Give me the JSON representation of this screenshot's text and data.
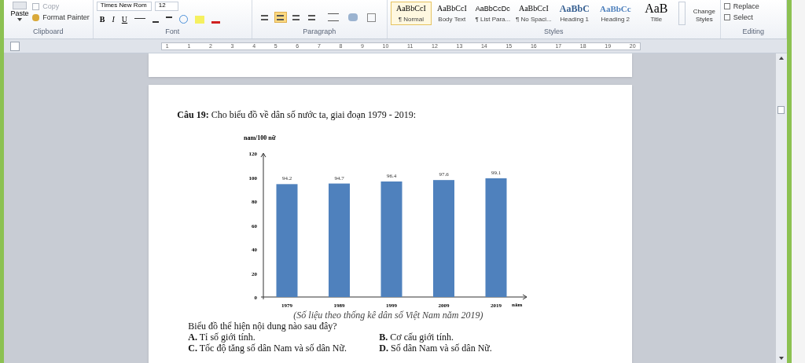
{
  "ribbon": {
    "clipboard": {
      "paste": "Paste",
      "items": [
        {
          "label": "Copy",
          "disabled": true
        },
        {
          "label": "Format Painter",
          "disabled": false
        }
      ],
      "label": "Clipboard"
    },
    "font": {
      "font_name": "Times New Rom",
      "font_size": "12",
      "format_buttons": [
        "B",
        "I",
        "U"
      ],
      "label": "Font"
    },
    "paragraph": {
      "alignments": [
        {
          "selected": false
        },
        {
          "selected": true
        },
        {
          "selected": false
        },
        {
          "selected": false
        }
      ],
      "label": "Paragraph"
    },
    "styles": {
      "items": [
        {
          "preview": "AaBbCcI",
          "name": "¶ Normal",
          "selected": true
        },
        {
          "preview": "AaBbCcI",
          "name": "Body Text",
          "selected": false
        },
        {
          "preview": "AaBbCcDc",
          "name": "¶ List Para...",
          "selected": false
        },
        {
          "preview": "AaBbCcI",
          "name": "¶ No Spaci...",
          "selected": false
        },
        {
          "preview": "AaBbC",
          "name": "Heading 1",
          "selected": false
        },
        {
          "preview": "AaBbCc",
          "name": "Heading 2",
          "selected": false
        },
        {
          "preview": "AaB",
          "name": "Title",
          "selected": false
        }
      ],
      "change_styles": "Change Styles",
      "label": "Styles"
    },
    "editing": {
      "items": [
        "Replace",
        "Select"
      ],
      "label": "Editing"
    }
  },
  "ruler": {
    "labels": [
      "1",
      "1",
      "2",
      "3",
      "4",
      "5",
      "6",
      "7",
      "8",
      "9",
      "10",
      "11",
      "12",
      "13",
      "14",
      "15",
      "16",
      "17",
      "18",
      "19",
      "20"
    ]
  },
  "document": {
    "question": "**Câu 19:** Cho biểu đồ về dân số nước ta, giai đoạn 1979 - 2019:",
    "chart_data": {
      "type": "bar",
      "ylabel": "nam/100 nữ",
      "xlabel": "năm",
      "categories": [
        "1979",
        "1989",
        "1999",
        "2009",
        "2019"
      ],
      "series": [
        {
          "color": "#4f81bd",
          "values": [
            94.2,
            94.7,
            96.4,
            97.6,
            99.1
          ]
        }
      ],
      "ylim": [
        0,
        120
      ],
      "yticks": [
        0,
        20,
        40,
        60,
        80,
        100,
        120
      ],
      "data_labels": true
    },
    "caption": "(Số liệu theo thống kê dân số Việt Nam năm 2019)",
    "prompt": "Biểu đồ thể hiện nội dung nào sau đây?",
    "options": [
      "**A.** Tỉ số giới tính.",
      "**B.** Cơ cấu giới tính.",
      "**C.** Tốc độ tăng số dân Nam và số dân Nữ.",
      "**D.** Số dân Nam và số dân Nữ."
    ]
  }
}
